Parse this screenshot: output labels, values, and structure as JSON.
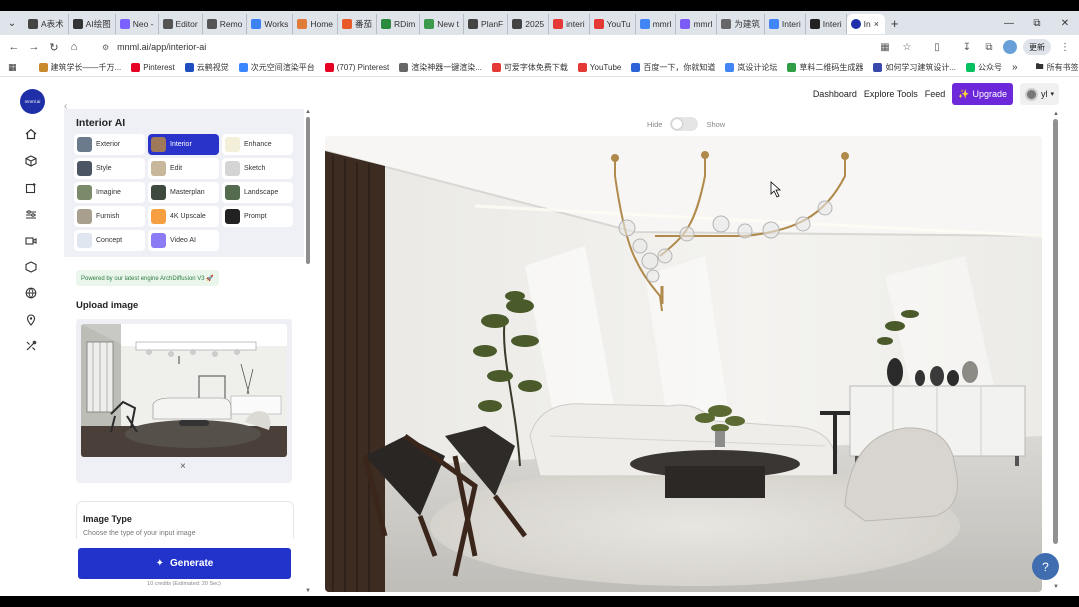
{
  "browser": {
    "tabs": [
      {
        "label": "A表术",
        "color": "#444"
      },
      {
        "label": "AI绘图",
        "color": "#333"
      },
      {
        "label": "Neo -",
        "color": "#7b61ff"
      },
      {
        "label": "Editor",
        "color": "#555"
      },
      {
        "label": "Remo",
        "color": "#555"
      },
      {
        "label": "Works",
        "color": "#3b82f6"
      },
      {
        "label": "Home",
        "color": "#e07b39"
      },
      {
        "label": "番茄",
        "color": "#e85a2a"
      },
      {
        "label": "RDim",
        "color": "#2b8a3e"
      },
      {
        "label": "New t",
        "color": "#3b9a4b"
      },
      {
        "label": "PlanF",
        "color": "#444"
      },
      {
        "label": "2025",
        "color": "#444"
      },
      {
        "label": "interi",
        "color": "#e53935"
      },
      {
        "label": "YouTu",
        "color": "#e53935"
      },
      {
        "label": "mmrl",
        "color": "#4285f4"
      },
      {
        "label": "mmrl",
        "color": "#7a5cf5"
      },
      {
        "label": "为建筑",
        "color": "#666"
      },
      {
        "label": "Interi",
        "color": "#4285f4"
      },
      {
        "label": "Interi",
        "color": "#222"
      }
    ],
    "active_tab": {
      "label": "In",
      "color": "#1e2fa8"
    },
    "url": "mnml.ai/app/interior-ai",
    "relaunch_label": "更新"
  },
  "bookmarks": [
    {
      "label": "建筑学长——千万...",
      "color": "#c9892d"
    },
    {
      "label": "Pinterest",
      "color": "#e60023"
    },
    {
      "label": "云鹤视觉",
      "color": "#1f4fbf"
    },
    {
      "label": "次元空间渲染平台",
      "color": "#3a86ff"
    },
    {
      "label": "(707) Pinterest",
      "color": "#e60023"
    },
    {
      "label": "渲染神器一键渲染...",
      "color": "#666"
    },
    {
      "label": "可爱字体免费下载",
      "color": "#e53935"
    },
    {
      "label": "YouTube",
      "color": "#e53935"
    },
    {
      "label": "百度一下，你就知道",
      "color": "#2d63d6"
    },
    {
      "label": "岚设计论坛",
      "color": "#4285f4"
    },
    {
      "label": "草料二维码生成器",
      "color": "#2f9e44"
    },
    {
      "label": "如何学习建筑设计...",
      "color": "#3949ab"
    },
    {
      "label": "公众号",
      "color": "#07c160"
    }
  ],
  "bookmarks_all": "所有书签",
  "nav": {
    "dashboard": "Dashboard",
    "explore": "Explore Tools",
    "feed": "Feed",
    "upgrade": "Upgrade",
    "user": "yl"
  },
  "logo_text": "mnml.ai",
  "panel": {
    "title": "Interior AI",
    "modes": [
      {
        "label": "Exterior",
        "color": "#6b7b8c"
      },
      {
        "label": "Interior",
        "color": "#a0785a",
        "selected": true
      },
      {
        "label": "Enhance",
        "color": "#f3efd8"
      },
      {
        "label": "Style",
        "color": "#4b5563"
      },
      {
        "label": "Edit",
        "color": "#c9b79c"
      },
      {
        "label": "Sketch",
        "color": "#d4d4d4"
      },
      {
        "label": "Imagine",
        "color": "#7a8a6a"
      },
      {
        "label": "Masterplan",
        "color": "#3f4a3f"
      },
      {
        "label": "Landscape",
        "color": "#556b4f"
      },
      {
        "label": "Furnish",
        "color": "#a89f8f"
      },
      {
        "label": "4K Upscale",
        "color": "#f59e42"
      },
      {
        "label": "Prompt",
        "color": "#222222"
      },
      {
        "label": "Concept",
        "color": "#e0e6f0"
      },
      {
        "label": "Video AI",
        "color": "#8b7cf6"
      }
    ],
    "powered": "Powered by our latest engine ArchDiffusion V3 🚀",
    "upload_label": "Upload image",
    "remove": "×",
    "image_type_title": "Image Type",
    "image_type_desc": "Choose the type of your input image",
    "generate": "Generate",
    "credits": "10 credits (Estimated: 20 Sec)"
  },
  "toggle": {
    "hide": "Hide",
    "show": "Show",
    "on": false
  },
  "help": "?",
  "colors": {
    "accent": "#2233cc",
    "upgrade": "#6d28d9",
    "logo": "#1e2fa8"
  }
}
